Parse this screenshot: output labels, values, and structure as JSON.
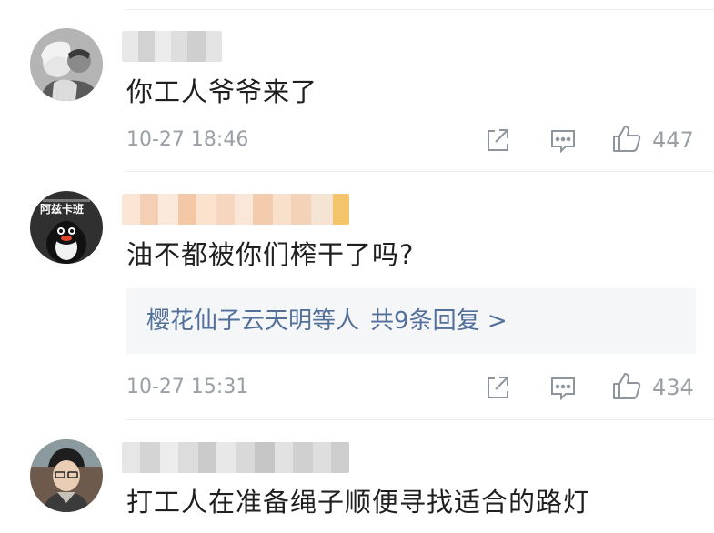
{
  "comments": [
    {
      "text": "你工人爷爷来了",
      "time": "10-27 18:46",
      "likes": "447",
      "avatar_icon": "avatar-couple-photo-icon",
      "username_blurred": true
    },
    {
      "text": "油不都被你们榨干了吗?",
      "time": "10-27 15:31",
      "likes": "434",
      "avatar_icon": "avatar-penguin-icon",
      "avatar_label": "阿兹卡班",
      "username_blurred": true,
      "replies": {
        "names": "樱花仙子云天明",
        "suffix": "等人",
        "count": "共9条回复 >"
      }
    },
    {
      "text": "打工人在准备绳子顺便寻找适合的路灯",
      "avatar_icon": "avatar-illustrated-man-icon",
      "username_blurred": true
    }
  ],
  "icons": {
    "share": "share-icon",
    "reply": "comment-icon",
    "like": "thumbs-up-icon"
  },
  "colors": {
    "link": "#52709a",
    "meta": "#9aa0a6",
    "reply_bg": "#f5f6f8"
  }
}
